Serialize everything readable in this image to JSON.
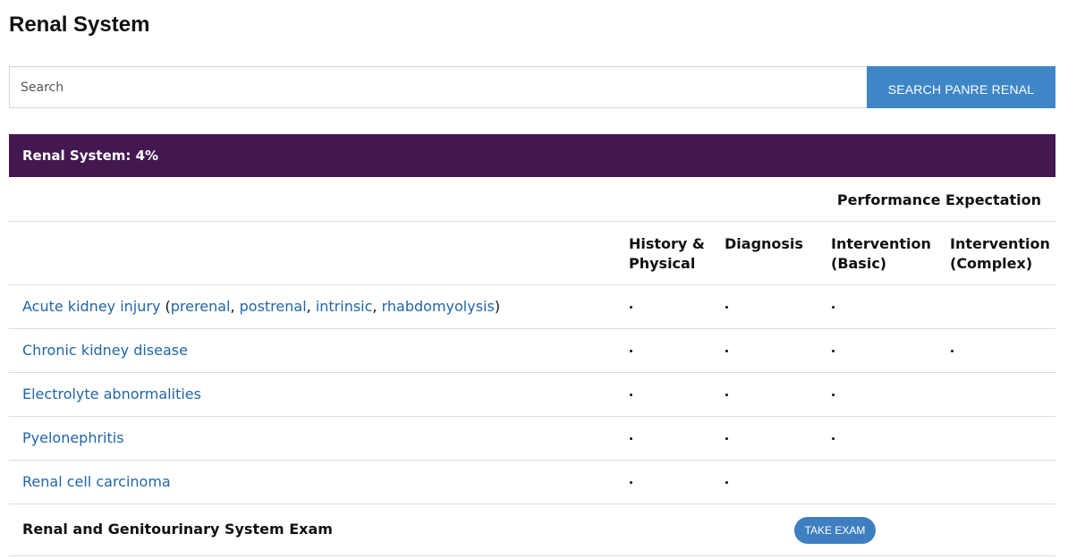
{
  "page": {
    "title": "Renal System"
  },
  "search": {
    "placeholder": "Search",
    "button_label": "SEARCH PANRE RENAL"
  },
  "section": {
    "header": "Renal System: 4%"
  },
  "table": {
    "performance_label": "Performance Expectation",
    "columns": [
      "History &\nPhysical",
      "Diagnosis",
      "Intervention\n(Basic)",
      "Intervention\n(Complex)"
    ],
    "rows": [
      {
        "title": "Acute kidney injury",
        "open_paren": " (",
        "subtopics": [
          "prerenal",
          "postrenal",
          "intrinsic",
          "rhabdomyolysis"
        ],
        "separator": ", ",
        "close_paren": ")",
        "marks": [
          true,
          true,
          true,
          false
        ]
      },
      {
        "title": "Chronic kidney disease",
        "marks": [
          true,
          true,
          true,
          true
        ]
      },
      {
        "title": "Electrolyte abnormalities",
        "marks": [
          true,
          true,
          true,
          false
        ]
      },
      {
        "title": "Pyelonephritis",
        "marks": [
          true,
          true,
          true,
          false
        ]
      },
      {
        "title": "Renal cell carcinoma",
        "marks": [
          true,
          true,
          false,
          false
        ]
      }
    ],
    "exam": {
      "label": "Renal and Genitourinary System Exam",
      "button_label": "TAKE EXAM"
    }
  },
  "colors": {
    "header_bg": "#431851",
    "button_bg": "#3f86c7",
    "link": "#2166a8"
  }
}
